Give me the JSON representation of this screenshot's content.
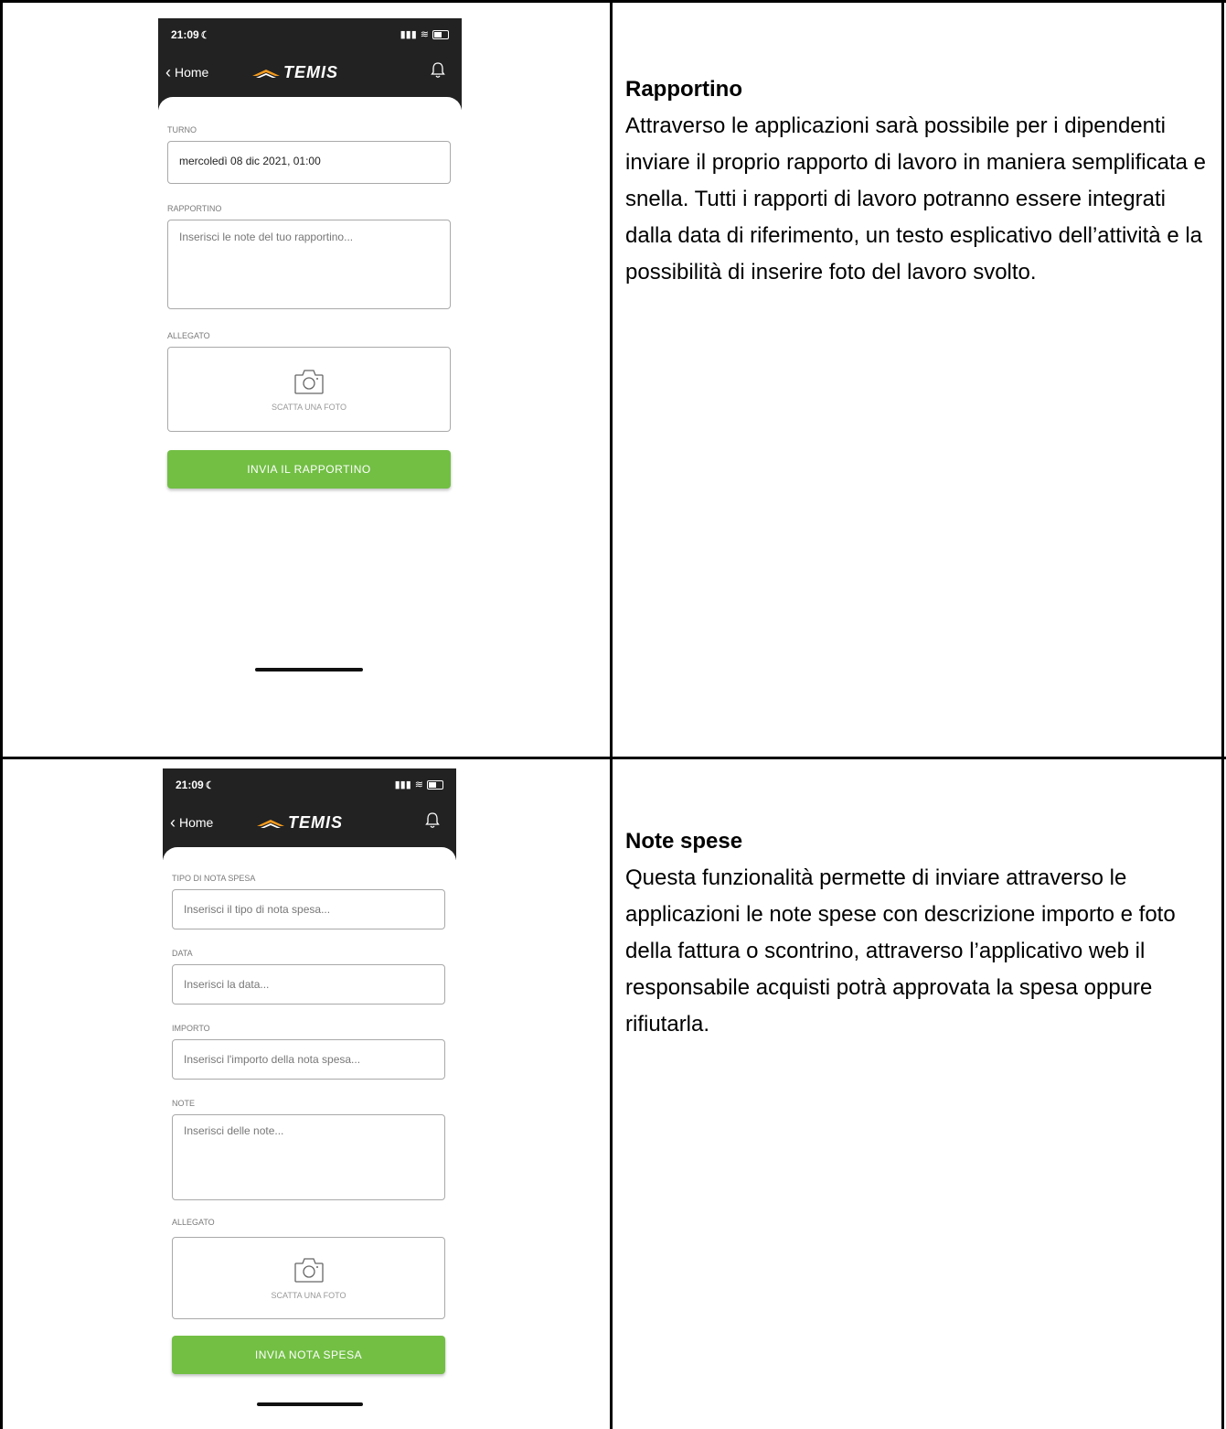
{
  "phone": {
    "time": "21:09",
    "back_label": "Home",
    "logo_text": "TEMIS",
    "accent_color": "#f39a1e",
    "button_color": "#72bf44",
    "camera_icon": "camera-icon",
    "bell_icon": "bell-icon"
  },
  "row1": {
    "screen": {
      "turno_label": "TURNO",
      "turno_value": "mercoledì 08 dic 2021, 01:00",
      "rapportino_label": "RAPPORTINO",
      "rapportino_placeholder": "Inserisci le note del tuo rapportino...",
      "allegato_label": "ALLEGATO",
      "photo_caption": "SCATTA UNA FOTO",
      "submit_label": "INVIA IL RAPPORTINO"
    },
    "title": "Rapportino",
    "body": "Attraverso le applicazioni sarà possibile per i dipendenti inviare il proprio rapporto di lavoro in maniera semplificata e snella. Tutti i rapporti di lavoro potranno essere integrati dalla data di riferimento, un testo esplicativo dell’attività e la possibilità di inserire foto del lavoro svolto."
  },
  "row2": {
    "screen": {
      "tipo_label": "TIPO DI NOTA SPESA",
      "tipo_placeholder": "Inserisci il tipo di nota spesa...",
      "data_label": "DATA",
      "data_placeholder": "Inserisci la data...",
      "importo_label": "IMPORTO",
      "importo_placeholder": "Inserisci l'importo della nota spesa...",
      "note_label": "NOTE",
      "note_placeholder": "Inserisci delle note...",
      "allegato_label": "ALLEGATO",
      "photo_caption": "SCATTA UNA FOTO",
      "submit_label": "INVIA NOTA SPESA"
    },
    "title": "Note spese",
    "body": "Questa funzionalità permette di inviare attraverso le applicazioni le note spese con descrizione importo e foto della fattura o scontrino, attraverso l’applicativo web il responsabile acquisti potrà approvata la spesa oppure rifiutarla."
  }
}
